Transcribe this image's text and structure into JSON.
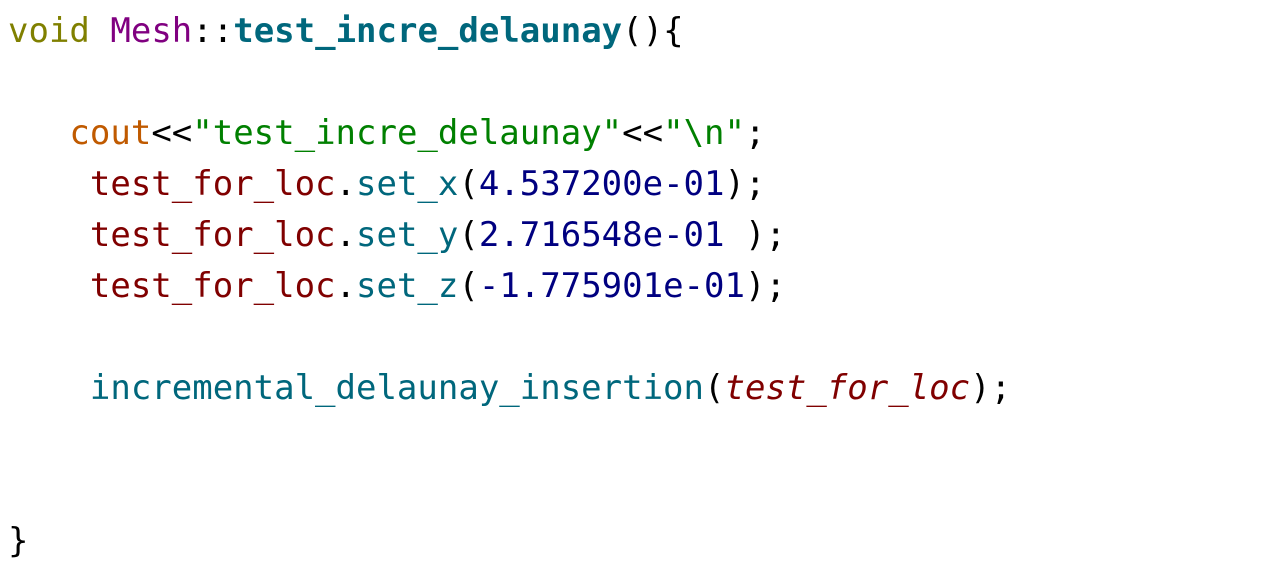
{
  "code": {
    "line1": {
      "keyword": "void",
      "class_name": "Mesh",
      "scope": "::",
      "function_name": "test_incre_delaunay",
      "open": "(){"
    },
    "line3": {
      "indent": "   ",
      "stream": "cout",
      "op1": "<<",
      "string1": "\"test_incre_delaunay\"",
      "op2": "<<",
      "string2": "\"\\n\"",
      "end": ";"
    },
    "line4": {
      "indent": "    ",
      "object": "test_for_loc",
      "dot": ".",
      "method": "set_x",
      "open": "(",
      "value": "4.537200e-01",
      "close": ");"
    },
    "line5": {
      "indent": "    ",
      "object": "test_for_loc",
      "dot": ".",
      "method": "set_y",
      "open": "(",
      "value": "2.716548e-01",
      "close": " );"
    },
    "line6": {
      "indent": "    ",
      "object": "test_for_loc",
      "dot": ".",
      "method": "set_z",
      "open": "(",
      "value": "-1.775901e-01",
      "close": ");"
    },
    "line8": {
      "indent": "    ",
      "call": "incremental_delaunay_insertion",
      "open": "(",
      "argument": "test_for_loc",
      "close": ");"
    },
    "line11": {
      "close_brace": "}"
    }
  },
  "colors": {
    "keyword": "#808000",
    "class": "#800080",
    "function": "#00677c",
    "cout": "#c05a00",
    "string": "#008000",
    "variable": "#800000",
    "number": "#000080"
  }
}
